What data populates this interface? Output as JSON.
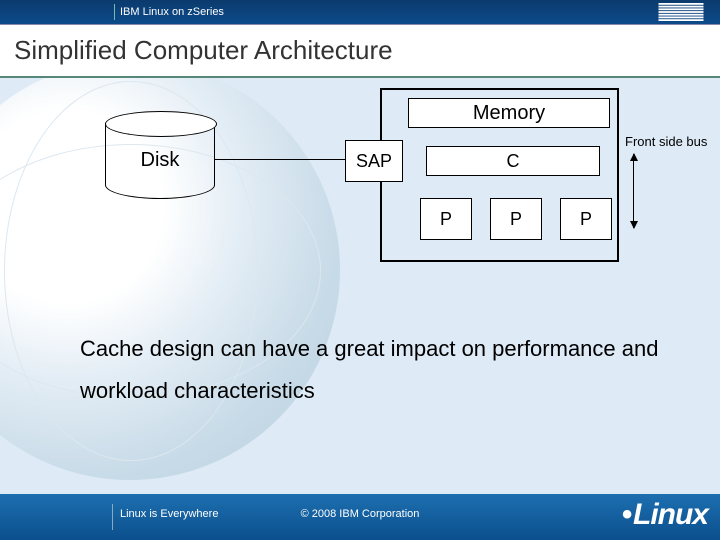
{
  "topbar": {
    "title": "IBM Linux on zSeries"
  },
  "header": {
    "title": "Simplified Computer Architecture"
  },
  "diagram": {
    "disk": "Disk",
    "memory": "Memory",
    "sap": "SAP",
    "cache": "C",
    "p1": "P",
    "p2": "P",
    "p3": "P",
    "fsb": "Front side bus"
  },
  "body": "Cache design can have a great impact on performance and workload characteristics",
  "footer": {
    "left": "Linux is Everywhere",
    "mid": "© 2008 IBM Corporation",
    "logo": "Linux"
  }
}
